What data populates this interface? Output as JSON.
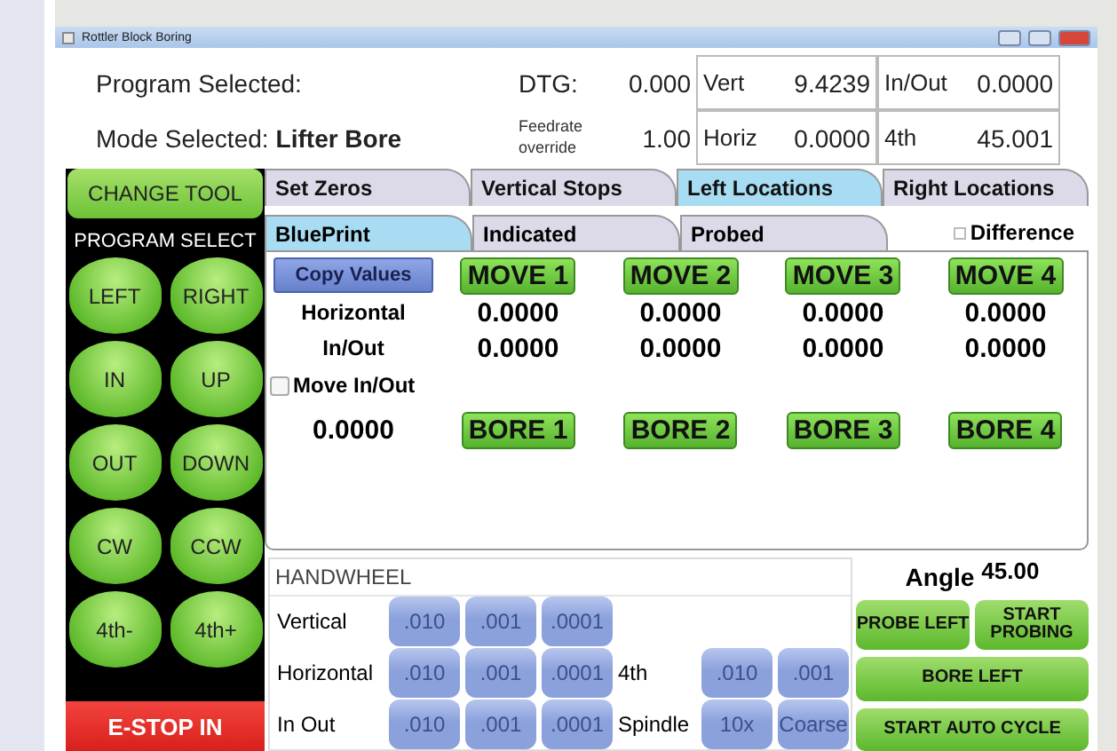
{
  "window": {
    "title": "Rottler Block Boring"
  },
  "header": {
    "program_label": "Program Selected:",
    "mode_label": "Mode Selected:",
    "mode_value": "Lifter Bore",
    "dtg_label": "DTG:",
    "dtg_value": "0.000",
    "feedrate_label": "Feedrate override",
    "feedrate_value": "1.00",
    "readouts": [
      {
        "label": "Vert",
        "value": "9.4239"
      },
      {
        "label": "In/Out",
        "value": "0.0000"
      },
      {
        "label": "Horiz",
        "value": "0.0000"
      },
      {
        "label": "4th",
        "value": "45.001"
      }
    ]
  },
  "sidebar": {
    "change_tool": "CHANGE TOOL",
    "program_select": "PROGRAM SELECT",
    "jog_buttons": [
      "LEFT",
      "RIGHT",
      "IN",
      "UP",
      "OUT",
      "DOWN",
      "CW",
      "CCW",
      "4th-",
      "4th+"
    ],
    "estop": "E-STOP IN"
  },
  "tabs": [
    {
      "label": "Set Zeros",
      "selected": false
    },
    {
      "label": "Vertical Stops",
      "selected": false
    },
    {
      "label": "Left Locations",
      "selected": true
    },
    {
      "label": "Right Locations",
      "selected": false
    }
  ],
  "subtabs": [
    {
      "label": "BluePrint",
      "selected": true
    },
    {
      "label": "Indicated",
      "selected": false
    },
    {
      "label": "Probed",
      "selected": false
    }
  ],
  "difference": {
    "label": "Difference",
    "checked": false
  },
  "locations": {
    "copy_values": "Copy Values",
    "move_buttons": [
      "MOVE 1",
      "MOVE 2",
      "MOVE 3",
      "MOVE 4"
    ],
    "rows": [
      {
        "label": "Horizontal",
        "values": [
          "0.0000",
          "0.0000",
          "0.0000",
          "0.0000"
        ]
      },
      {
        "label": "In/Out",
        "values": [
          "0.0000",
          "0.0000",
          "0.0000",
          "0.0000"
        ]
      }
    ],
    "move_in_out": {
      "label": "Move In/Out",
      "checked": false,
      "value": "0.0000"
    },
    "bore_buttons": [
      "BORE 1",
      "BORE 2",
      "BORE 3",
      "BORE 4"
    ]
  },
  "handwheel": {
    "title": "HANDWHEEL",
    "rows": [
      {
        "label": "Vertical",
        "steps": [
          ".010",
          ".001",
          ".0001"
        ]
      },
      {
        "label": "Horizontal",
        "steps": [
          ".010",
          ".001",
          ".0001"
        ],
        "extra_label": "4th",
        "extra_steps": [
          ".010",
          ".001"
        ]
      },
      {
        "label": "In Out",
        "steps": [
          ".010",
          ".001",
          ".0001"
        ],
        "extra_label": "Spindle",
        "extra_steps": [
          "10x",
          "Coarse"
        ]
      }
    ]
  },
  "actions": {
    "angle_label": "Angle",
    "angle_value": "45.00",
    "probe_left": "PROBE LEFT",
    "start_probing": "START PROBING",
    "bore_left": "BORE LEFT",
    "start_auto_cycle": "START AUTO CYCLE"
  }
}
